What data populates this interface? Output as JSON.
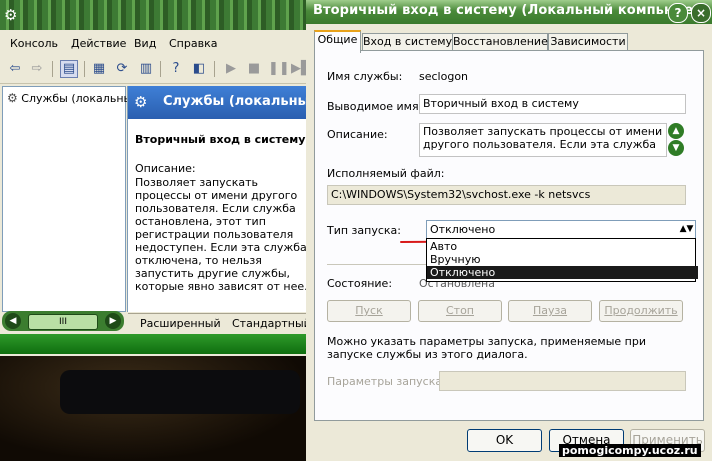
{
  "mmc": {
    "menu": [
      "Консоль",
      "Действие",
      "Вид",
      "Справка"
    ],
    "tree_item": "Службы (локальные",
    "header_title": "Службы (локальные)",
    "service_name": "Вторичный вход в систему",
    "description_label": "Описание:",
    "description_text": "Позволяет запускать процессы от имени другого пользователя. Если служба остановлена, этот тип регистрации пользователя недоступен. Если эта служба отключена, то нельзя запустить другие службы, которые явно зависят от нее.",
    "scroll_label": "III",
    "tabs": [
      "Расширенный",
      "Стандартный"
    ]
  },
  "dialog": {
    "title": "Вторичный вход в систему (Локальный компьютер) ...",
    "help_label": "?",
    "close_label": "×",
    "tabs": [
      "Общие",
      "Вход в систему",
      "Восстановление",
      "Зависимости"
    ],
    "service_name_label": "Имя службы:",
    "service_name_value": "seclogon",
    "display_name_label": "Выводимое имя:",
    "display_name_value": "Вторичный вход в систему",
    "description_label": "Описание:",
    "description_value": "Позволяет запускать процессы от имени другого пользователя. Если эта служба",
    "exe_label": "Исполняемый файл:",
    "exe_value": "C:\\WINDOWS\\System32\\svchost.exe -k netsvcs",
    "startup_label": "Тип запуска:",
    "startup_value": "Отключено",
    "startup_options": [
      "Авто",
      "Вручную",
      "Отключено"
    ],
    "state_label": "Состояние:",
    "state_value": "Остановлена",
    "buttons": {
      "start": "Пуск",
      "stop": "Стоп",
      "pause": "Пауза",
      "resume": "Продолжить"
    },
    "hint_text": "Можно указать параметры запуска, применяемые при запуске службы из этого диалога.",
    "params_label": "Параметры запуска:",
    "params_value": "",
    "ok": "OK",
    "cancel": "Отмена",
    "apply": "Применить"
  },
  "watermark": "pomogicompy.ucoz.ru",
  "colors": {
    "xp_green": "#3a7a2d",
    "selection": "#1a1a1a",
    "annotation_red": "#d81a1a"
  }
}
